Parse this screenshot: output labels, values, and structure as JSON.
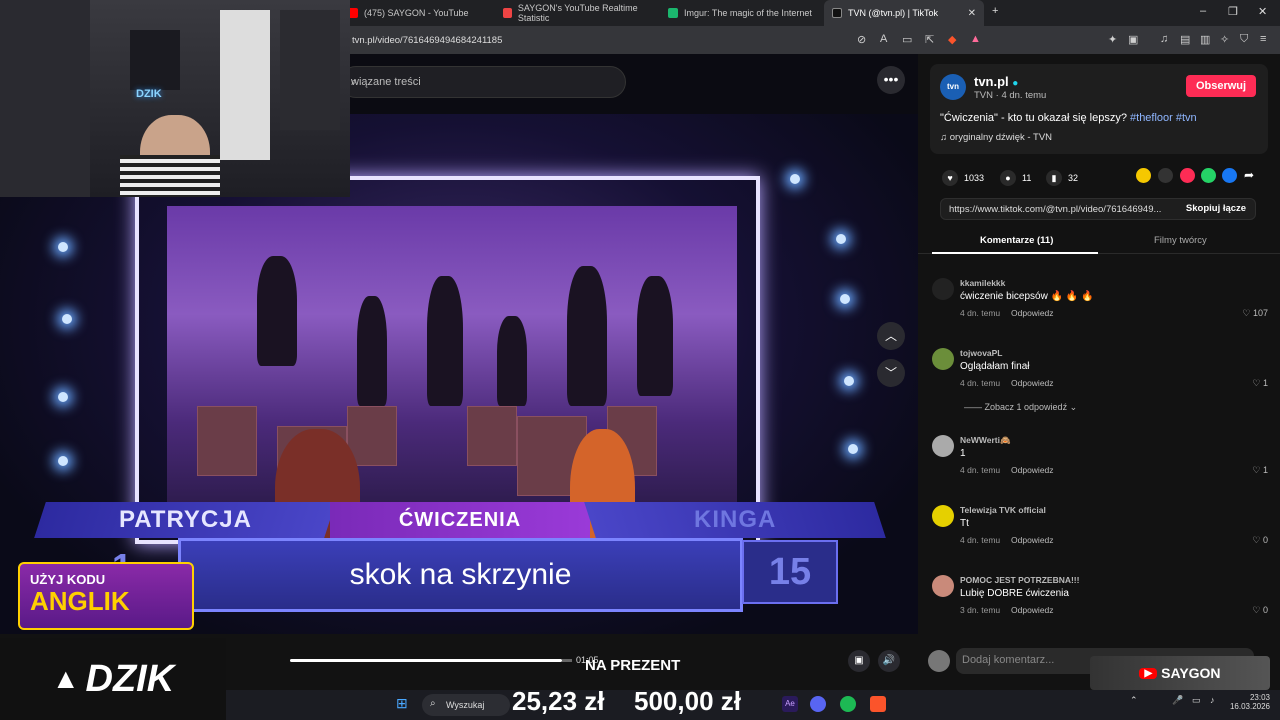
{
  "browser": {
    "tabs": [
      {
        "label": "(475) SAYGON - YouTube"
      },
      {
        "label": "SAYGON's YouTube Realtime Statistic"
      },
      {
        "label": "Imgur: The magic of the Internet"
      },
      {
        "label": "TVN (@tvn.pl) | TikTok"
      }
    ],
    "url": "tvn.pl/video/7616469494684241185"
  },
  "video": {
    "search_placeholder": "wiązane treści",
    "player": {
      "label_left": "PATRYCJA",
      "label_mid": "ĆWICZENIA",
      "label_right": "KINGA",
      "answer": "skok na skrzynie",
      "score_right": "15",
      "score_left_partial": "1"
    },
    "time": "01:05",
    "overlay_text": "NA PREZENT"
  },
  "promo": {
    "line1": "UŻYJ KODU",
    "line2": "ANGLIK"
  },
  "brand": {
    "dzik": "DZIK"
  },
  "taskbar": {
    "search": "Wyszukaj",
    "amount1": "25,23 zł",
    "amount2": "500,00 zł",
    "time": "23:03",
    "date": "16.03.2026"
  },
  "sidebar": {
    "author": "tvn.pl",
    "author_meta": "TVN · 4 dn. temu",
    "follow_label": "Obserwuj",
    "caption_text": "\"Ćwiczenia\" - kto tu okazał się lepszy?",
    "hashtags": "#thefloor #tvn",
    "sound": "oryginalny dźwięk - TVN",
    "likes": "1033",
    "comments_count": "11",
    "saves": "32",
    "link": "https://www.tiktok.com/@tvn.pl/video/761646949...",
    "copy_label": "Skopiuj łącze",
    "tab_comments": "Komentarze (11)",
    "tab_creator": "Filmy twórcy",
    "reply_label": "Odpowiedz",
    "view_replies": "Zobacz 1 odpowiedź",
    "comments": [
      {
        "user": "kkamilekkk",
        "text": "ćwiczenie bicepsów 🔥 🔥 🔥",
        "time": "4 dn. temu",
        "likes": "107"
      },
      {
        "user": "tojwovaPL",
        "text": "Oglądałam finał",
        "time": "4 dn. temu",
        "likes": "1"
      },
      {
        "user": "NeWWerti🙈",
        "text": "1",
        "time": "4 dn. temu",
        "likes": "1"
      },
      {
        "user": "Telewizja TVK official",
        "text": "Tt",
        "time": "4 dn. temu",
        "likes": "0"
      },
      {
        "user": "POMOC JEST POTRZEBNA!!!",
        "text": "Lubię DOBRE ćwiczenia",
        "time": "3 dn. temu",
        "likes": "0"
      }
    ],
    "add_comment_placeholder": "Dodaj komentarz...",
    "channel_logo": "SAYGON"
  }
}
